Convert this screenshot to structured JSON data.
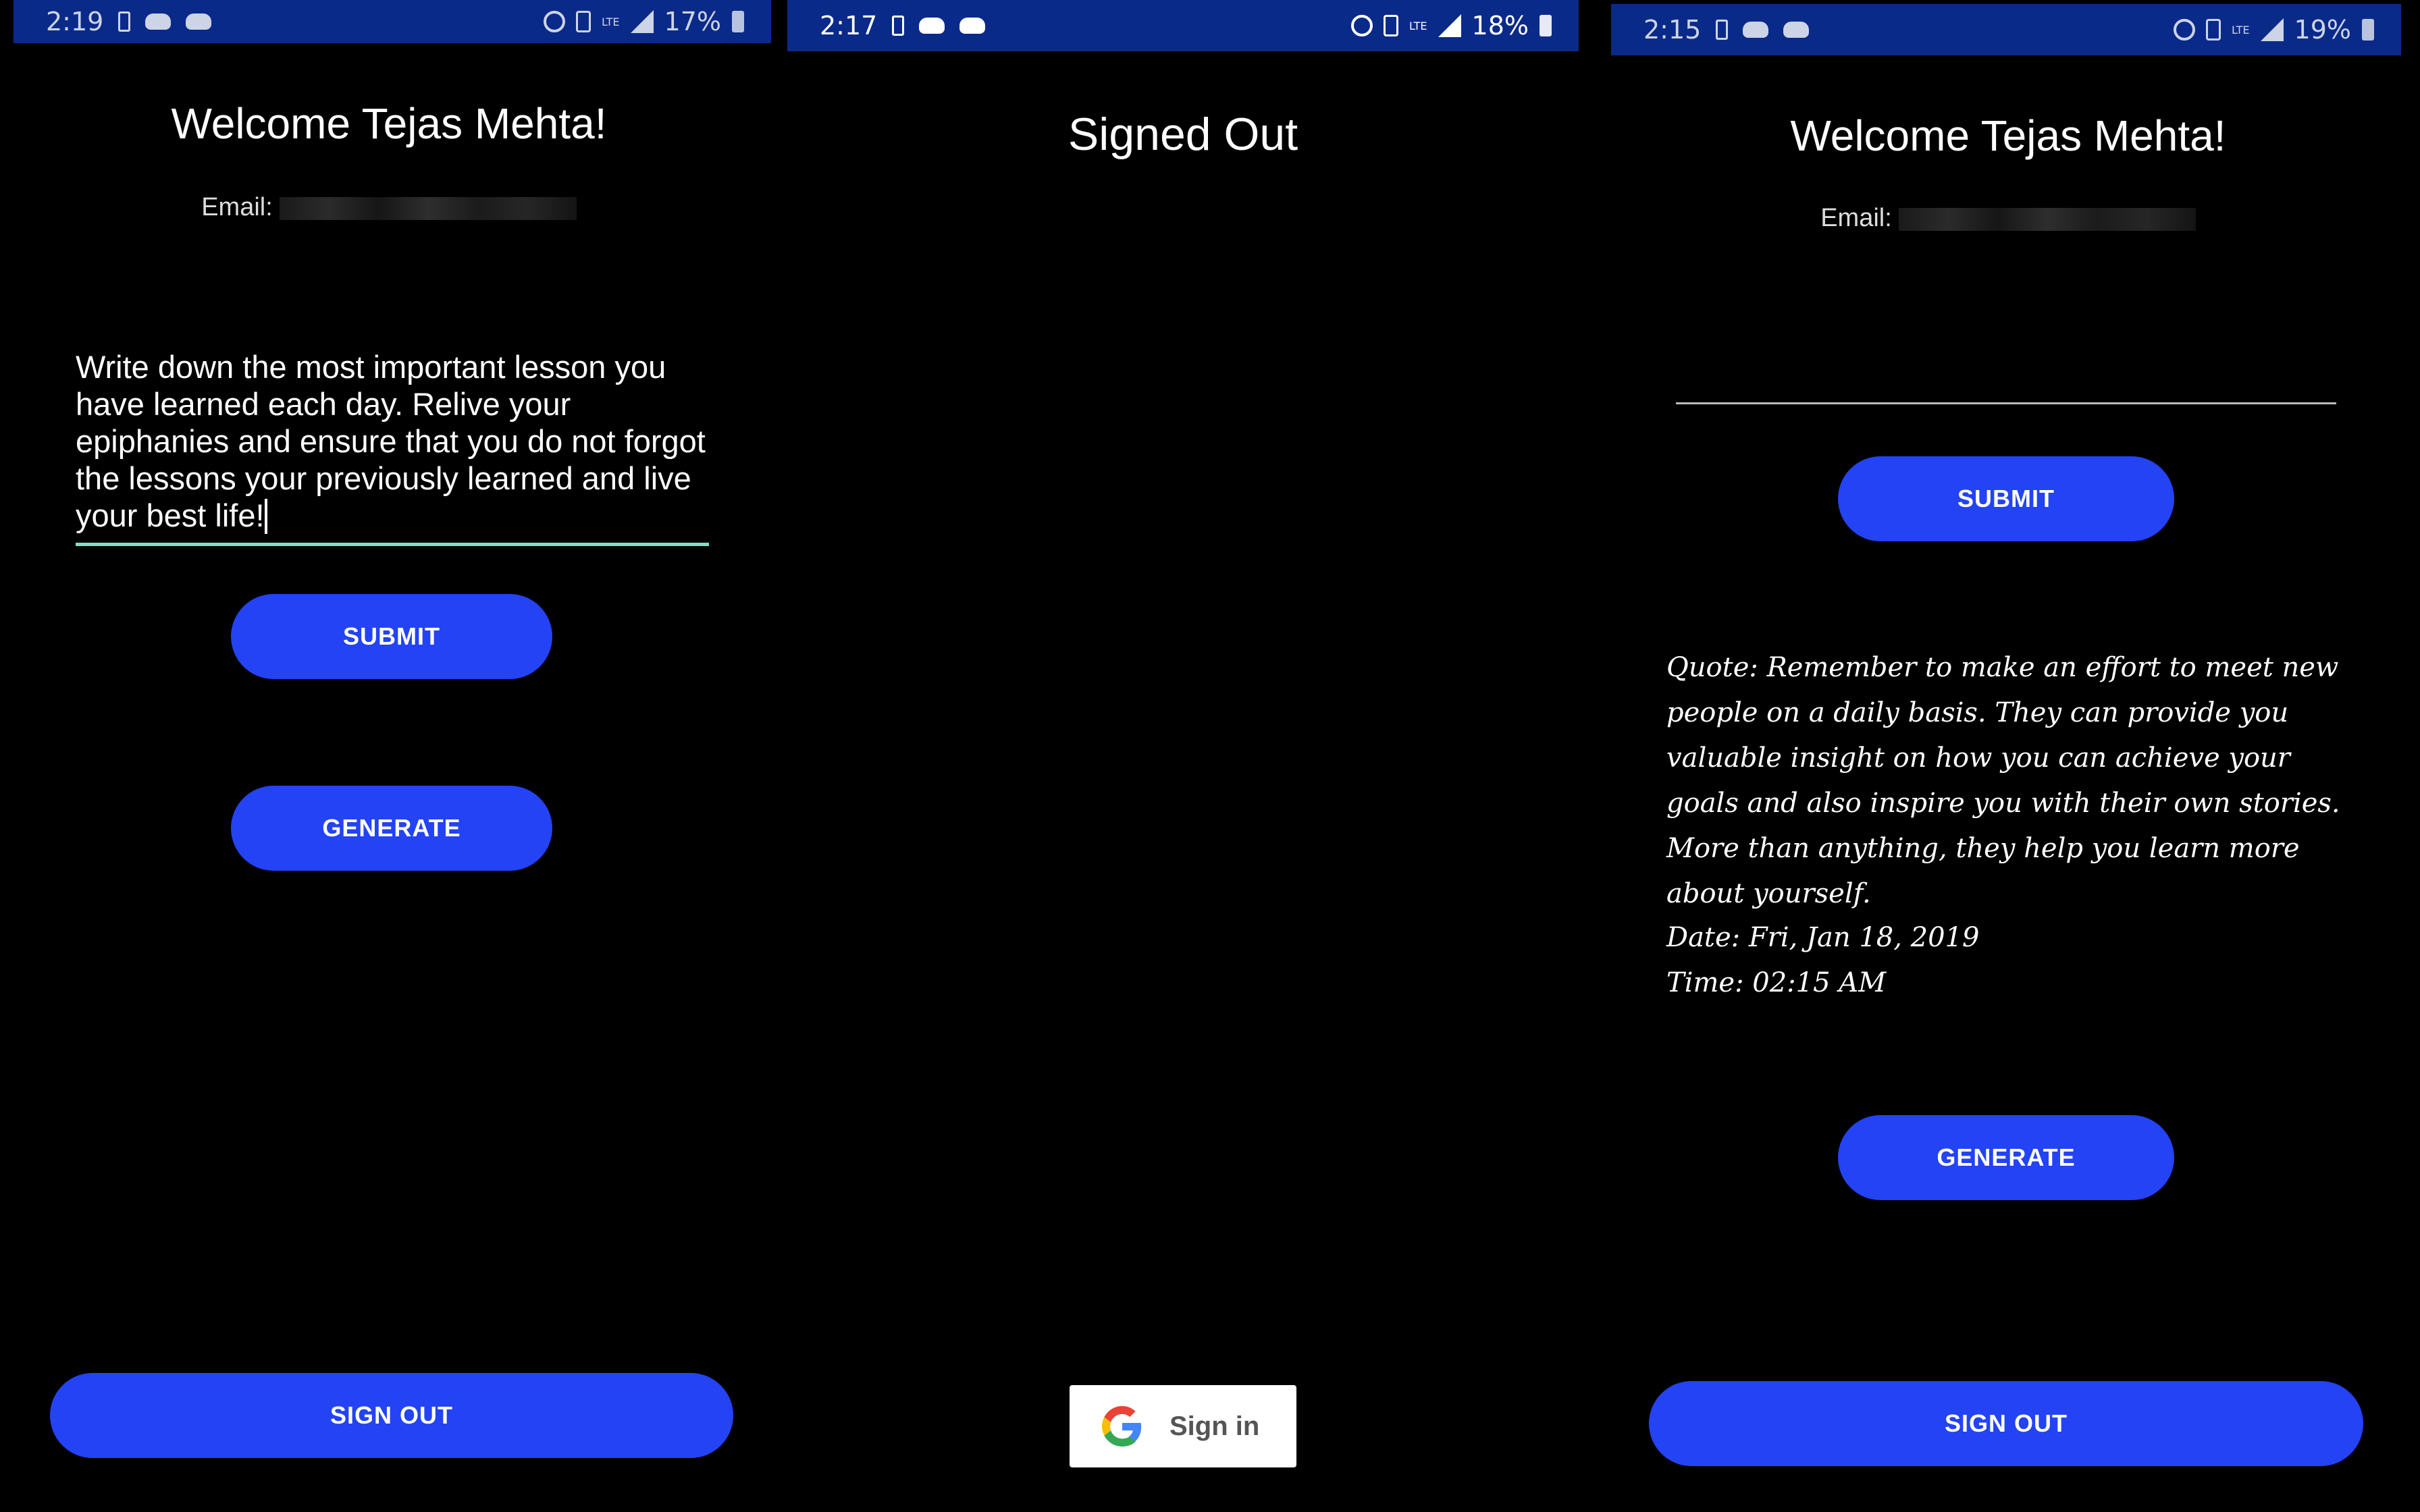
{
  "panel_left": {
    "status": {
      "time": "2:19",
      "lte": "LTE",
      "battery": "17%"
    },
    "welcome": "Welcome Tejas Mehta!",
    "email_label": "Email:",
    "lesson_input_value": "Write down the most important lesson you have learned each day. Relive your epiphanies and ensure that you do not forgot the lessons your previously learned and live your best life!",
    "submit_label": "SUBMIT",
    "generate_label": "GENERATE",
    "signout_label": "SIGN OUT"
  },
  "panel_middle": {
    "status": {
      "time": "2:17",
      "lte": "LTE",
      "battery": "18%"
    },
    "title": "Signed Out",
    "signin_label": "Sign in"
  },
  "panel_right": {
    "status": {
      "time": "2:15",
      "lte": "LTE",
      "battery": "19%"
    },
    "welcome": "Welcome Tejas Mehta!",
    "email_label": "Email:",
    "submit_label": "SUBMIT",
    "quote_text": "Quote: Remember to make an effort to meet new people on a daily basis. They can provide you valuable insight on how you can achieve your goals and also inspire you with their own stories. More than anything, they help you learn more about yourself.",
    "date_text": "Date: Fri, Jan 18, 2019",
    "time_text": "Time: 02:15 AM",
    "generate_label": "GENERATE",
    "signout_label": "SIGN OUT"
  },
  "colors": {
    "accent": "#2343f5",
    "statusbar": "#0a2a8a",
    "input_underline": "#7fe0c8"
  },
  "icons": [
    "battery-charging-icon",
    "game-controller-icon",
    "hotspot-icon",
    "vibrate-icon",
    "signal-icon",
    "battery-icon",
    "google-g-icon"
  ]
}
